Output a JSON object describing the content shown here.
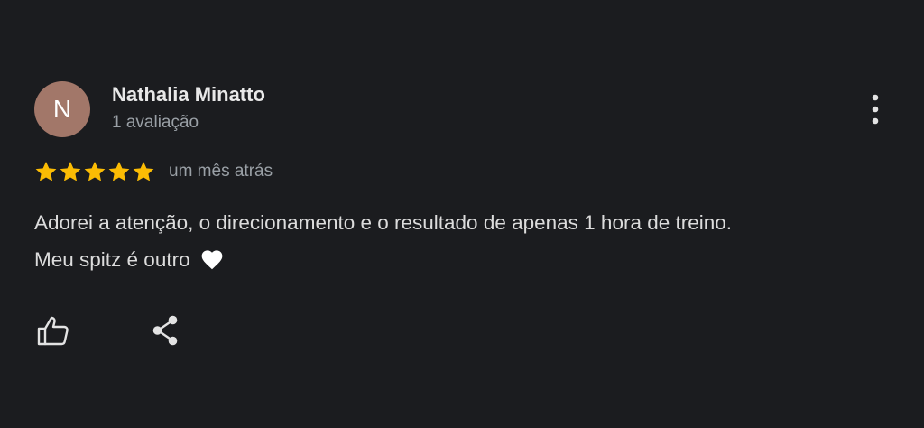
{
  "review": {
    "author": {
      "name": "Nathalia Minatto",
      "initial": "N",
      "avatar_color": "#a27769",
      "review_count_label": "1 avaliação"
    },
    "rating": {
      "stars": 5,
      "max_stars": 5,
      "star_color": "#fbbc04"
    },
    "date": "um mês atrás",
    "text_line1": "Adorei a atenção, o direcionamento e o resultado de apenas 1 hora de treino.",
    "text_line2": "Meu spitz é outro"
  },
  "icons": {
    "more": "more-vert-icon",
    "heart": "white-heart-icon",
    "like": "thumbs-up-icon",
    "share": "share-icon"
  },
  "colors": {
    "background": "#1b1c1f",
    "icon": "#e3e3e3"
  }
}
